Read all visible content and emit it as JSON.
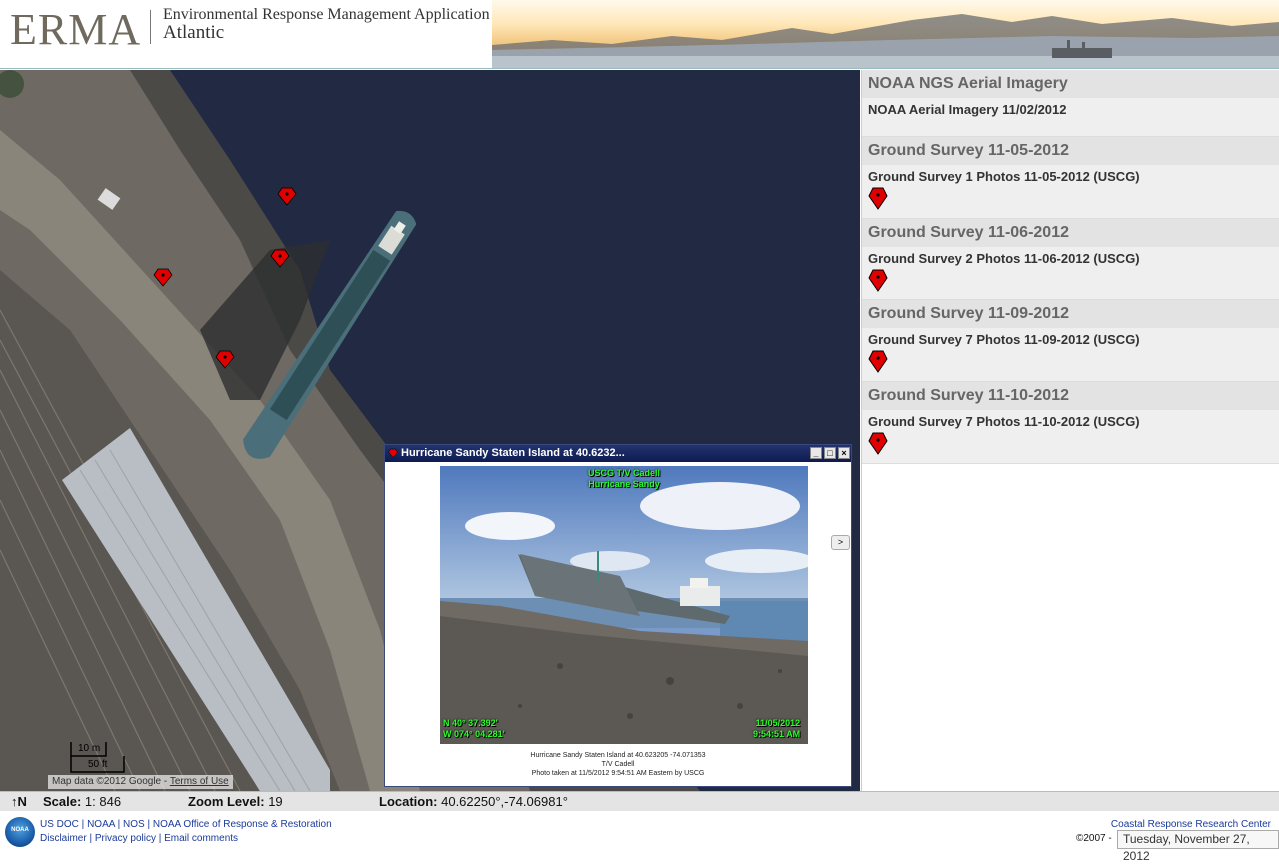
{
  "header": {
    "logo": "ERMA",
    "app_title": "Environmental Response Management Application",
    "region": "Atlantic"
  },
  "map": {
    "markers": [
      "incident-photo",
      "incident-photo",
      "incident-photo",
      "incident-photo"
    ],
    "scale_bar": {
      "metric": "10 m",
      "imperial": "50 ft"
    },
    "attribution": {
      "text": "Map data ©2012 Google - ",
      "terms": "Terms of Use"
    }
  },
  "popup": {
    "title": "Hurricane Sandy Staten Island at 40.6232...",
    "photo_overlay": {
      "top_line1": "USCG T/V Cadell",
      "top_line2": "Hurricane Sandy",
      "lat": "N 40° 37.392'",
      "lon": "W 074° 04.281'",
      "date": "11/05/2012",
      "time": "9:54:51 AM"
    },
    "caption": {
      "line1": "Hurricane Sandy Staten Island at 40.623205 -74.071353",
      "line2": "T/V Cadell",
      "line3": "Photo taken at 11/5/2012 9:54:51 AM Eastern by USCG"
    },
    "next_label": ">",
    "minimize": "_",
    "maximize": "□",
    "close": "×"
  },
  "sidebar": {
    "groups": [
      {
        "title": "NOAA NGS Aerial Imagery",
        "item": "NOAA Aerial Imagery 11/02/2012"
      },
      {
        "title": "Ground Survey 11-05-2012",
        "item": "Ground Survey 1 Photos 11-05-2012 (USCG)"
      },
      {
        "title": "Ground Survey 11-06-2012",
        "item": "Ground Survey 2 Photos 11-06-2012 (USCG)"
      },
      {
        "title": "Ground Survey 11-09-2012",
        "item": "Ground Survey 7 Photos 11-09-2012 (USCG)"
      },
      {
        "title": "Ground Survey 11-10-2012",
        "item": "Ground Survey 7 Photos 11-10-2012 (USCG)"
      }
    ]
  },
  "status": {
    "north": "↑N",
    "scale_label": "Scale:",
    "scale_value": " 1: 846",
    "zoom_label": "Zoom Level:",
    "zoom_value": " 19",
    "location_label": "Location:",
    "location_value": " 40.62250°,-74.06981°"
  },
  "footer": {
    "noaa": "NOAA",
    "links1": [
      "US DOC",
      "NOAA",
      "NOS",
      "NOAA Office of Response & Restoration"
    ],
    "links2": [
      "Disclaimer",
      "Privacy policy",
      "Email comments"
    ],
    "crrc": "Coastal Response Research Center",
    "copyright": "©2007 -",
    "date": "Tuesday, November 27, 2012"
  },
  "colors": {
    "marker": "#e00000",
    "popup_bar": "#1a2a66",
    "group_title": "#666666"
  }
}
